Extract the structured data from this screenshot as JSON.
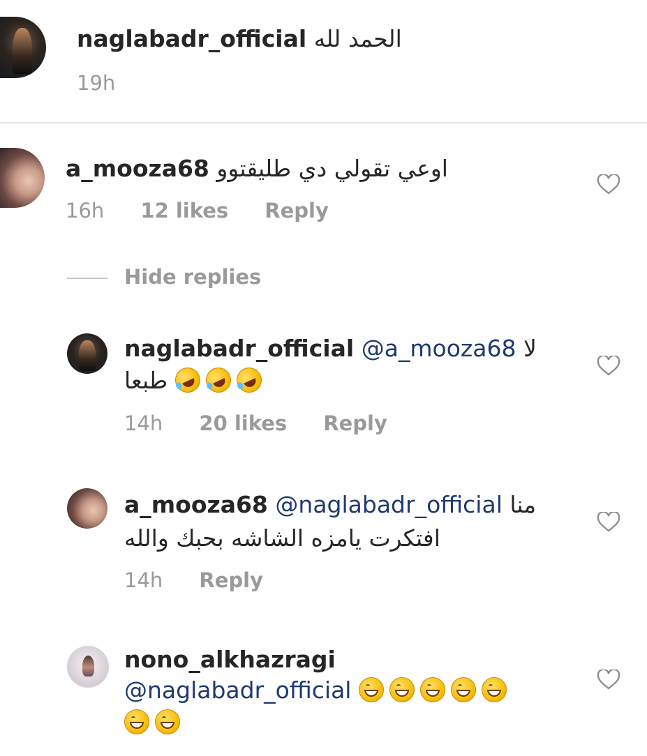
{
  "post": {
    "username": "naglabadr_official",
    "caption": "الحمد لله",
    "time": "19h"
  },
  "comments": [
    {
      "username": "a_mooza68",
      "text": "اوعي تقولي دي طليقتوو",
      "time": "16h",
      "likes": "12 likes",
      "reply": "Reply"
    }
  ],
  "hide_replies": "Hide replies",
  "replies": [
    {
      "username": "naglabadr_official",
      "mention": "@a_mooza68",
      "text_line1": "لا",
      "text_line2": "طبعا",
      "emojis": [
        "rolling-on-floor-laughing",
        "rolling-on-floor-laughing",
        "rolling-on-floor-laughing"
      ],
      "time": "14h",
      "likes": "20 likes",
      "reply": "Reply"
    },
    {
      "username": "a_mooza68",
      "mention": "@naglabadr_official",
      "text_line1": "منا",
      "text_line2": "افتكرت يامزه الشاشه بحبك والله",
      "time": "14h",
      "reply": "Reply"
    },
    {
      "username": "nono_alkhazragi",
      "mention": "@naglabadr_official",
      "emojis": [
        "grinning-face",
        "grinning-face",
        "grinning-face",
        "grinning-face",
        "grinning-face",
        "grinning-face",
        "grinning-face"
      ]
    }
  ],
  "colors": {
    "mention": "#1f3a6e",
    "meta": "#9a9a9a",
    "divider": "#e3e3e3"
  }
}
